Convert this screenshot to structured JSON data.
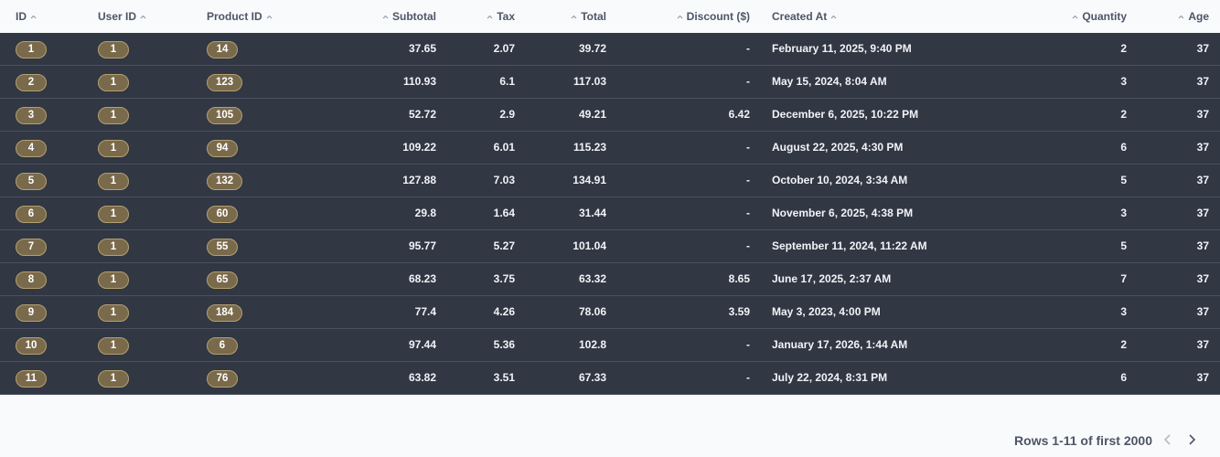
{
  "columns": [
    {
      "key": "id",
      "label": "ID"
    },
    {
      "key": "user_id",
      "label": "User ID"
    },
    {
      "key": "product_id",
      "label": "Product ID"
    },
    {
      "key": "subtotal",
      "label": "Subtotal"
    },
    {
      "key": "tax",
      "label": "Tax"
    },
    {
      "key": "total",
      "label": "Total"
    },
    {
      "key": "discount",
      "label": "Discount ($)"
    },
    {
      "key": "created_at",
      "label": "Created At"
    },
    {
      "key": "quantity",
      "label": "Quantity"
    },
    {
      "key": "age",
      "label": "Age"
    }
  ],
  "rows": [
    {
      "id": "1",
      "user_id": "1",
      "product_id": "14",
      "subtotal": "37.65",
      "tax": "2.07",
      "total": "39.72",
      "discount": "-",
      "created_at": "February 11, 2025, 9:40 PM",
      "quantity": "2",
      "age": "37"
    },
    {
      "id": "2",
      "user_id": "1",
      "product_id": "123",
      "subtotal": "110.93",
      "tax": "6.1",
      "total": "117.03",
      "discount": "-",
      "created_at": "May 15, 2024, 8:04 AM",
      "quantity": "3",
      "age": "37"
    },
    {
      "id": "3",
      "user_id": "1",
      "product_id": "105",
      "subtotal": "52.72",
      "tax": "2.9",
      "total": "49.21",
      "discount": "6.42",
      "created_at": "December 6, 2025, 10:22 PM",
      "quantity": "2",
      "age": "37"
    },
    {
      "id": "4",
      "user_id": "1",
      "product_id": "94",
      "subtotal": "109.22",
      "tax": "6.01",
      "total": "115.23",
      "discount": "-",
      "created_at": "August 22, 2025, 4:30 PM",
      "quantity": "6",
      "age": "37"
    },
    {
      "id": "5",
      "user_id": "1",
      "product_id": "132",
      "subtotal": "127.88",
      "tax": "7.03",
      "total": "134.91",
      "discount": "-",
      "created_at": "October 10, 2024, 3:34 AM",
      "quantity": "5",
      "age": "37"
    },
    {
      "id": "6",
      "user_id": "1",
      "product_id": "60",
      "subtotal": "29.8",
      "tax": "1.64",
      "total": "31.44",
      "discount": "-",
      "created_at": "November 6, 2025, 4:38 PM",
      "quantity": "3",
      "age": "37"
    },
    {
      "id": "7",
      "user_id": "1",
      "product_id": "55",
      "subtotal": "95.77",
      "tax": "5.27",
      "total": "101.04",
      "discount": "-",
      "created_at": "September 11, 2024, 11:22 AM",
      "quantity": "5",
      "age": "37"
    },
    {
      "id": "8",
      "user_id": "1",
      "product_id": "65",
      "subtotal": "68.23",
      "tax": "3.75",
      "total": "63.32",
      "discount": "8.65",
      "created_at": "June 17, 2025, 2:37 AM",
      "quantity": "7",
      "age": "37"
    },
    {
      "id": "9",
      "user_id": "1",
      "product_id": "184",
      "subtotal": "77.4",
      "tax": "4.26",
      "total": "78.06",
      "discount": "3.59",
      "created_at": "May 3, 2023, 4:00 PM",
      "quantity": "3",
      "age": "37"
    },
    {
      "id": "10",
      "user_id": "1",
      "product_id": "6",
      "subtotal": "97.44",
      "tax": "5.36",
      "total": "102.8",
      "discount": "-",
      "created_at": "January 17, 2026, 1:44 AM",
      "quantity": "2",
      "age": "37"
    },
    {
      "id": "11",
      "user_id": "1",
      "product_id": "76",
      "subtotal": "63.82",
      "tax": "3.51",
      "total": "67.33",
      "discount": "-",
      "created_at": "July 22, 2024, 8:31 PM",
      "quantity": "6",
      "age": "37"
    }
  ],
  "footer": {
    "row_count_text": "Rows 1-11 of first 2000",
    "prev_icon": "chevron-left-icon",
    "next_icon": "chevron-right-icon"
  },
  "colors": {
    "page_bg": "#f9fafc",
    "table_bg": "#313743",
    "pill_bg": "#7a6a4c",
    "pill_border": "#b4a070",
    "header_text": "#4d5566"
  }
}
